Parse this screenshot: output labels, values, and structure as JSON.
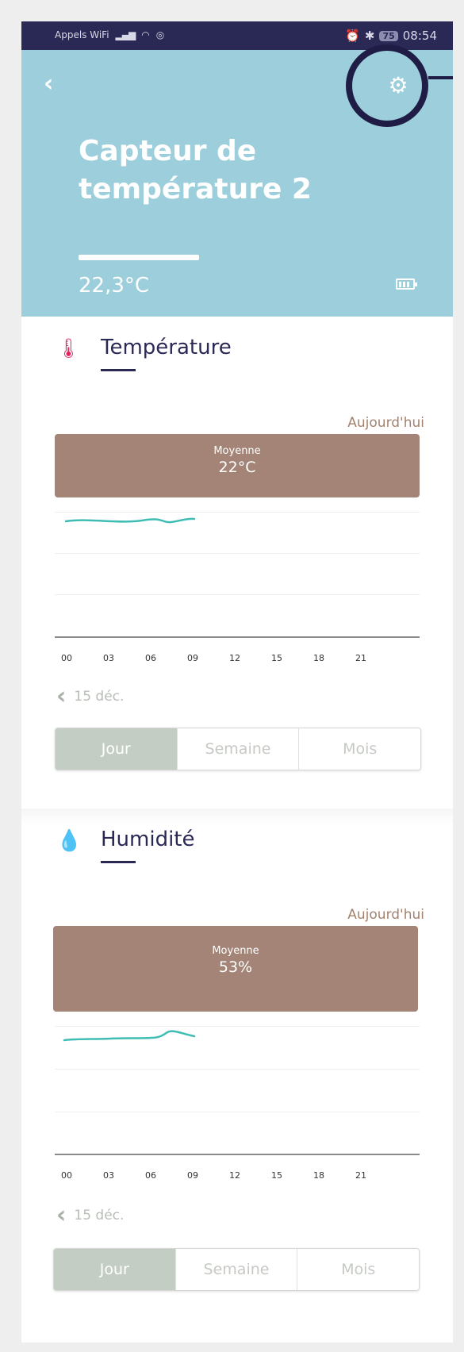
{
  "status_bar": {
    "carrier": "Appels WiFi",
    "battery": "75",
    "time": "08:54"
  },
  "header": {
    "back_icon": "chevron-left-icon",
    "settings_icon": "gear-icon",
    "title": "Capteur de température 2",
    "reading": "22,3°C",
    "battery_icon": "battery-full-icon",
    "background_color": "#9ccfdb"
  },
  "temperature": {
    "icon": "thermometer-icon",
    "title": "Température",
    "period_label": "Aujourd'hui",
    "average_label": "Moyenne",
    "average_value": "22°C",
    "hour_ticks": [
      "00",
      "03",
      "06",
      "09",
      "12",
      "15",
      "18",
      "21"
    ],
    "date": "15 déc.",
    "tabs": [
      {
        "label": "Jour",
        "active": true
      },
      {
        "label": "Semaine",
        "active": false
      },
      {
        "label": "Mois",
        "active": false
      }
    ]
  },
  "humidity": {
    "icon": "droplet-icon",
    "title": "Humidité",
    "period_label": "Aujourd'hui",
    "average_label": "Moyenne",
    "average_value": "53%",
    "hour_ticks": [
      "00",
      "03",
      "06",
      "09",
      "12",
      "15",
      "18",
      "21"
    ],
    "date": "15 déc.",
    "tabs": [
      {
        "label": "Jour",
        "active": true
      },
      {
        "label": "Semaine",
        "active": false
      },
      {
        "label": "Mois",
        "active": false
      }
    ]
  },
  "colors": {
    "status_bar": "#2a2956",
    "average_bar": "#a38476",
    "trend_line": "#3fbdb5",
    "active_tab": "#c4cdc4",
    "highlight_ring": "#1f1d45"
  }
}
